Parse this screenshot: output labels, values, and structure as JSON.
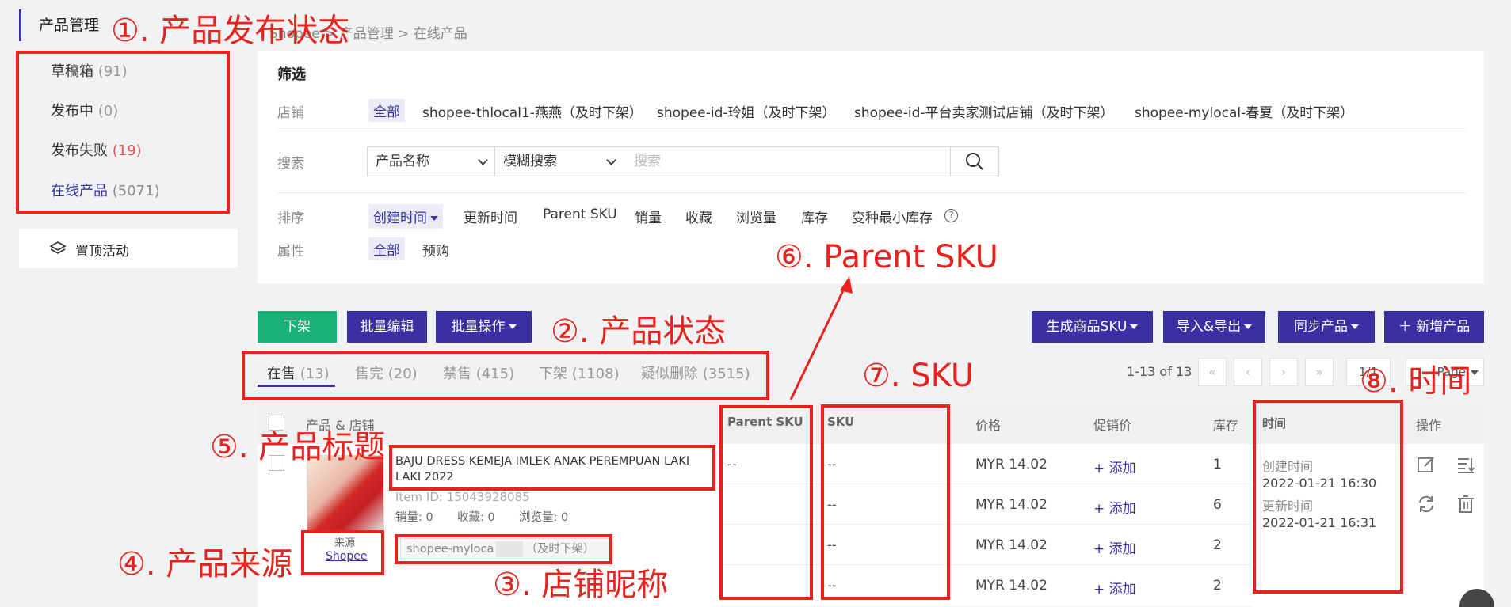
{
  "sidebar": {
    "title": "产品管理",
    "items": [
      {
        "label": "草稿箱",
        "count": "(91)"
      },
      {
        "label": "发布中",
        "count": "(0)"
      },
      {
        "label": "发布失败",
        "count": "(19)"
      },
      {
        "label": "在线产品",
        "count": "(5071)"
      }
    ],
    "pin_label": "置顶活动"
  },
  "breadcrumb": [
    "Shopee",
    "产品管理",
    "在线产品"
  ],
  "breadcrumb_sep": ">",
  "filter": {
    "title": "筛选",
    "shop_label": "店铺",
    "shop_all": "全部",
    "shops": [
      "shopee-thlocal1-燕燕（及时下架）",
      "shopee-id-玲姐（及时下架）",
      "shopee-id-平台卖家测试店铺（及时下架）",
      "shopee-mylocal-春夏（及时下架）"
    ],
    "search_label": "搜索",
    "search_field": "产品名称",
    "search_mode": "模糊搜索",
    "search_placeholder": "搜索",
    "sort_label": "排序",
    "sort_active": "创建时间",
    "sort_options": [
      "更新时间",
      "Parent SKU",
      "销量",
      "收藏",
      "浏览量",
      "库存",
      "变种最小库存"
    ],
    "help_glyph": "?",
    "attr_label": "属性",
    "attr_all": "全部",
    "attr_preorder": "预购"
  },
  "actions": {
    "delist": "下架",
    "bulk_edit": "批量编辑",
    "bulk_ops": "批量操作",
    "gen_sku": "生成商品SKU",
    "import_export": "导入&导出",
    "sync": "同步产品",
    "add_product": "＋ 新增产品"
  },
  "tabs": [
    {
      "label": "在售",
      "count": "(13)"
    },
    {
      "label": "售完",
      "count": "(20)"
    },
    {
      "label": "禁售",
      "count": "(415)"
    },
    {
      "label": "下架",
      "count": "(1108)"
    },
    {
      "label": "疑似删除",
      "count": "(3515)"
    }
  ],
  "pagination": {
    "info": "1-13 of 13",
    "first": "«",
    "prev": "‹",
    "next": "›",
    "last": "»",
    "page": "1/1",
    "per_page": "Page"
  },
  "table": {
    "headers": {
      "product": "产品 & 店铺",
      "parent_sku": "Parent SKU",
      "sku": "SKU",
      "price": "价格",
      "promo": "促销价",
      "stock": "库存",
      "time": "时间",
      "ops": "操作"
    },
    "product": {
      "title": "BAJU DRESS KEMEJA IMLEK ANAK PEREMPUAN LAKI LAKI 2022",
      "item_id": "Item ID: 15043928085",
      "sales": "销量: 0",
      "favs": "收藏: 0",
      "views": "浏览量: 0",
      "source_label": "来源",
      "source_value": "Shopee",
      "shop_name": "shopee-myloca",
      "shop_suffix": "（及时下架）",
      "parent_sku": "--",
      "created_label": "创建时间",
      "created": "2022-01-21 16:30",
      "updated_label": "更新时间",
      "updated": "2022-01-21 16:31"
    },
    "rows": [
      {
        "sku": "--",
        "price": "MYR  14.02",
        "promo": "+ 添加",
        "stock": "1"
      },
      {
        "sku": "--",
        "price": "MYR  14.02",
        "promo": "+ 添加",
        "stock": "6"
      },
      {
        "sku": "--",
        "price": "MYR  14.02",
        "promo": "+ 添加",
        "stock": "2"
      },
      {
        "sku": "--",
        "price": "MYR  14.02",
        "promo": "+ 添加",
        "stock": "2"
      }
    ]
  },
  "annotations": {
    "a1": "①. 产品发布状态",
    "a2": "②. 产品状态",
    "a3": "③. 店铺昵称",
    "a4": "④. 产品来源",
    "a5": "⑤. 产品标题",
    "a6": "⑥. Parent SKU",
    "a7": "⑦. SKU",
    "a8": "⑧. 时间"
  },
  "colors": {
    "accent": "#3b2fa3",
    "green": "#1ab07a",
    "annotation": "#e8221c"
  }
}
